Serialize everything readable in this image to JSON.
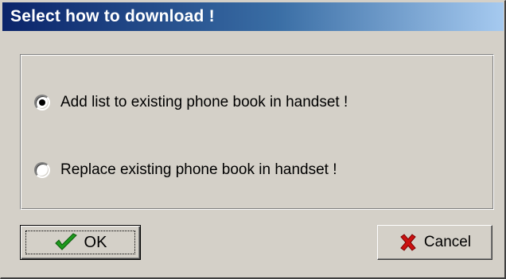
{
  "dialog": {
    "title": "Select how to download !"
  },
  "options": [
    {
      "label": "Add list to existing phone book in handset !",
      "selected": true
    },
    {
      "label": "Replace existing phone book in handset !",
      "selected": false
    }
  ],
  "buttons": {
    "ok_label": "OK",
    "ok_icon": "checkmark-icon",
    "cancel_label": "Cancel",
    "cancel_icon": "x-icon"
  },
  "colors": {
    "titlebar_start": "#0a246a",
    "titlebar_end": "#a6caf0",
    "face": "#d4d0c8",
    "ok_check": "#1e9a1e",
    "cancel_x": "#cc1111"
  }
}
